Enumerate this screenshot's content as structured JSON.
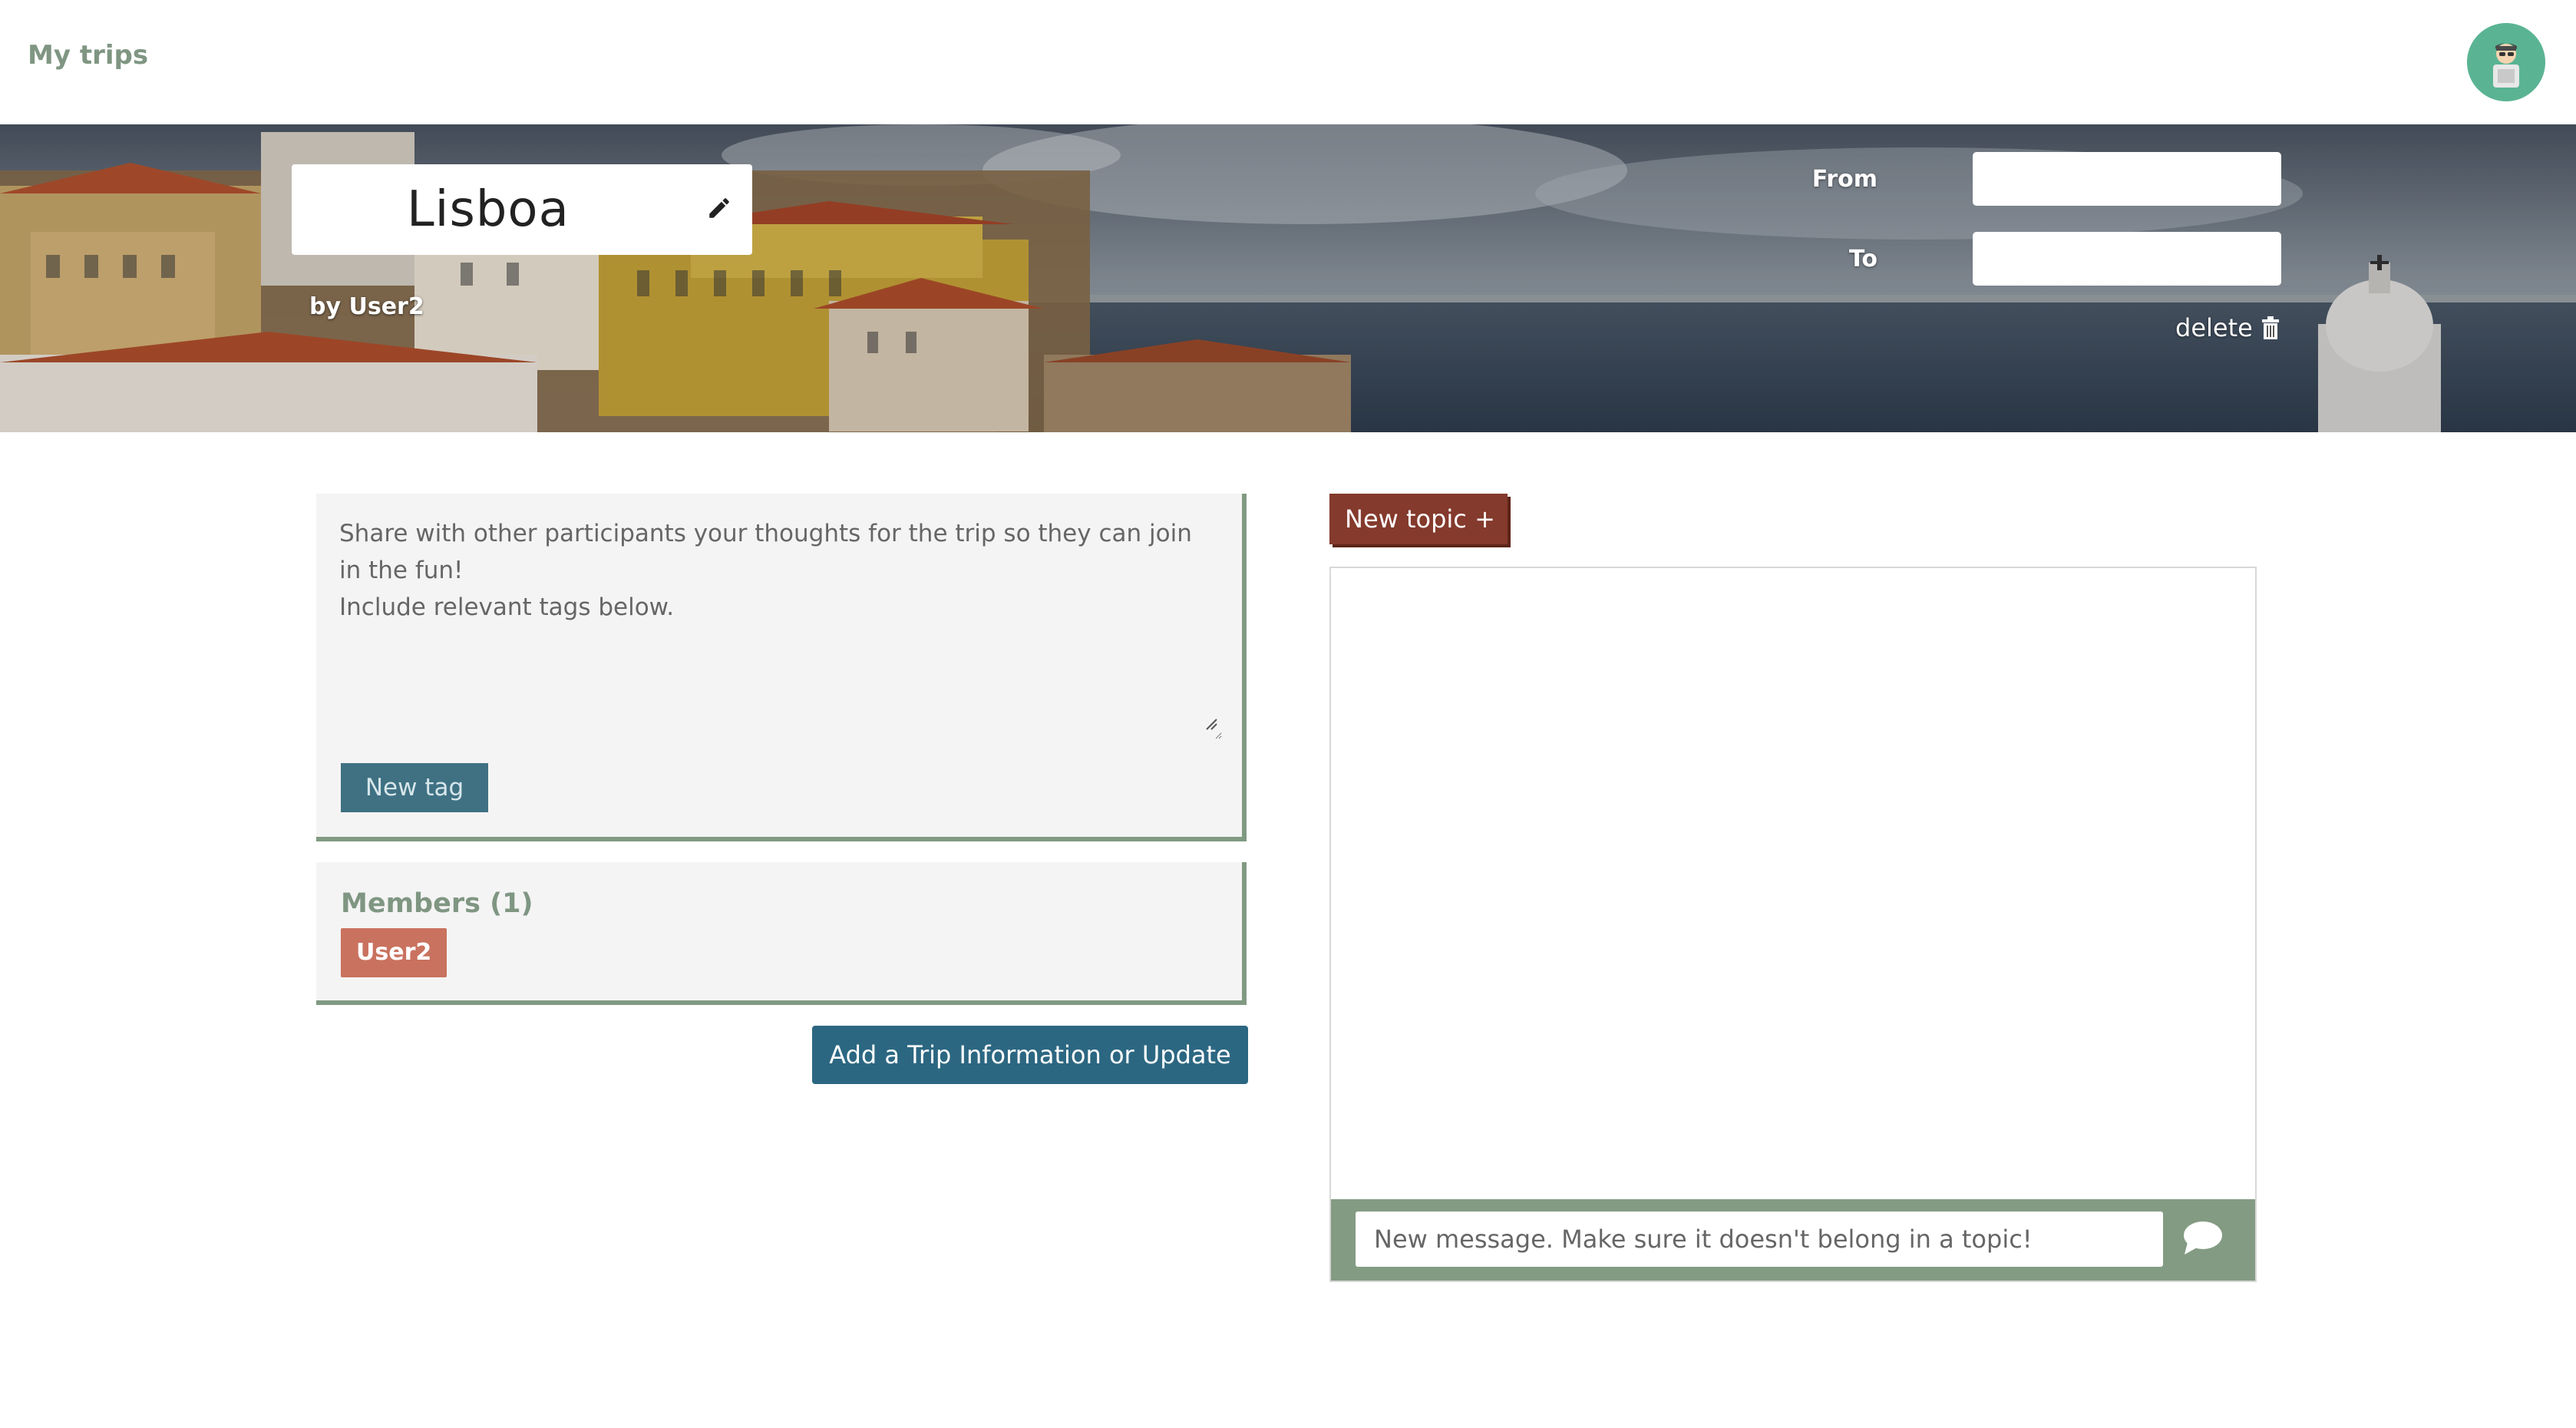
{
  "header": {
    "app_title": "My trips",
    "avatar_icon": "user-avatar-icon"
  },
  "trip": {
    "title": "Lisboa",
    "author": "by User2",
    "from_label": "From",
    "to_label": "To",
    "from_value": "",
    "to_value": "",
    "delete_label": "delete"
  },
  "description": {
    "placeholder": "Share with other participants your thoughts for the trip so they can join in the fun!\nInclude relevant tags below.",
    "new_tag_label": "New tag"
  },
  "members": {
    "title": "Members (1)",
    "list": [
      "User2"
    ]
  },
  "actions": {
    "add_info_label": "Add a Trip Information or Update"
  },
  "chat": {
    "new_topic_label": "New topic +",
    "message_placeholder": "New message. Make sure it doesn't belong in a topic!"
  },
  "colors": {
    "brand_green": "#7f9682",
    "tag_blue": "#3f7183",
    "topic_red": "#843a2c",
    "member_badge": "#c9725f",
    "primary_button": "#2c6782"
  }
}
